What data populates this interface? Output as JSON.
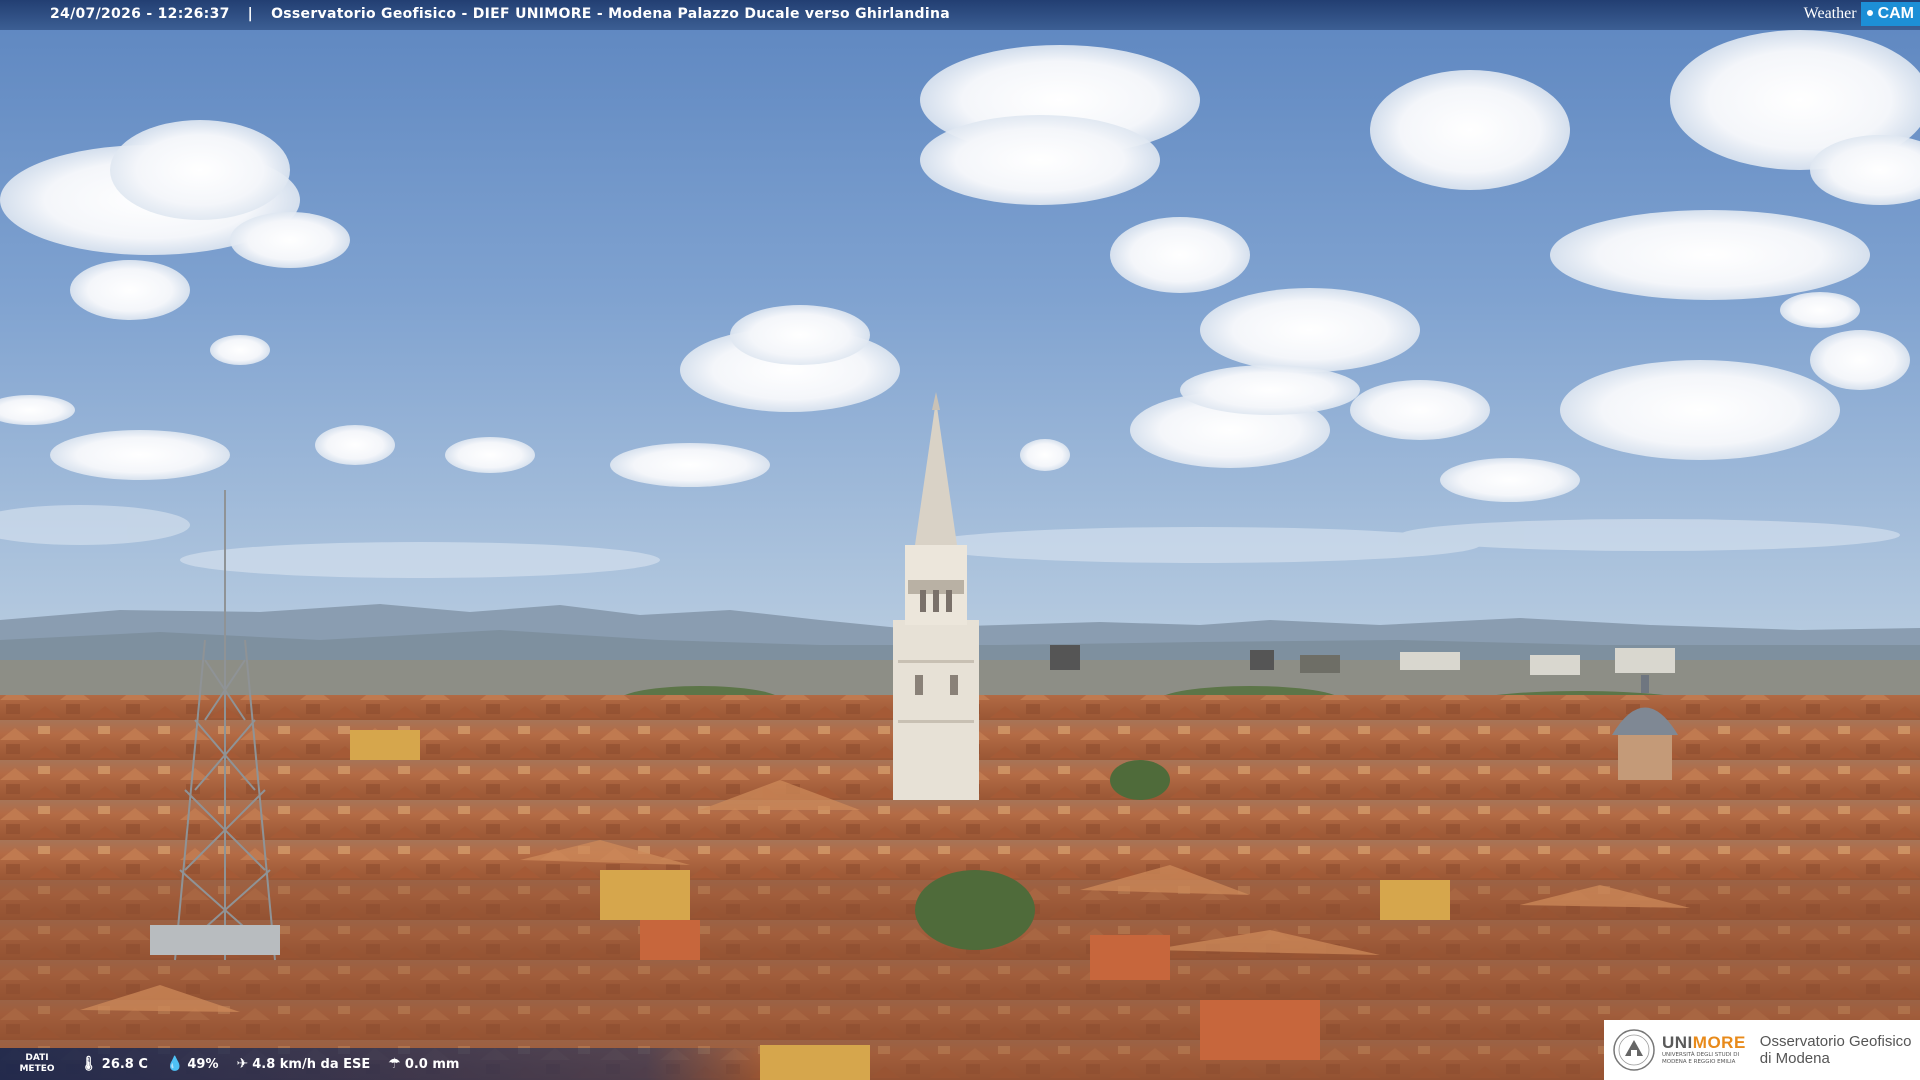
{
  "overlay": {
    "timestamp": "24/07/2026 - 12:26:37",
    "separator": "|",
    "camera_title": "Osservatorio Geofisico - DIEF UNIMORE - Modena Palazzo Ducale verso Ghirlandina",
    "brand": {
      "weather_text": "Weather",
      "cam_text": "CAM",
      "icon": "weathercam-logo"
    }
  },
  "weather": {
    "label_line1": "DATI",
    "label_line2": "METEO",
    "temperature": {
      "icon": "thermometer-icon",
      "value": "26.8 C"
    },
    "humidity": {
      "icon": "droplet-icon",
      "value": "49%"
    },
    "wind": {
      "icon": "wind-icon",
      "value": "4.8 km/h da ESE"
    },
    "rain": {
      "icon": "rain-icon",
      "value": "0.0 mm"
    }
  },
  "logo": {
    "university_short_1": "UNI",
    "university_short_2": "MORE",
    "university_full_line1": "UNIVERSITÀ DEGLI STUDI DI",
    "university_full_line2": "MODENA E REGGIO EMILIA",
    "observatory_line1": "Osservatorio Geofisico",
    "observatory_line2": "di Modena"
  },
  "colors": {
    "sky_top": "#5d86c0",
    "sky_bottom": "#b6cce0",
    "roof": "#b46b45",
    "tower": "#e7e1d6",
    "accent_orange": "#e88a1a",
    "brand_blue": "#1d8fd6"
  }
}
